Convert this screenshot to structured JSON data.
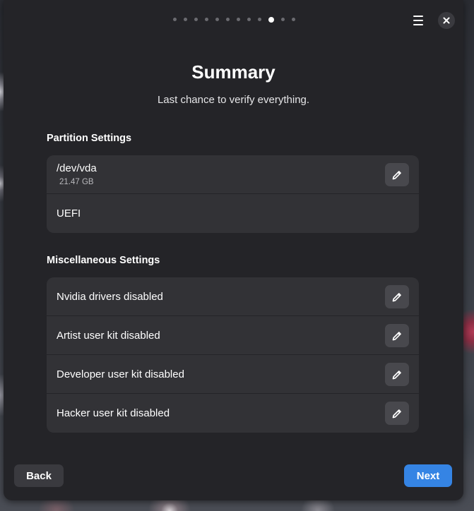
{
  "wizard": {
    "total_steps": 12,
    "current_step": 10,
    "title": "Summary",
    "subtitle": "Last chance to verify everything."
  },
  "header": {
    "menu_icon": "hamburger-menu-icon",
    "close_icon": "close-icon"
  },
  "partition": {
    "heading": "Partition Settings",
    "disk_name": "/dev/vda",
    "disk_size": "21.47 GB",
    "boot_mode": "UEFI",
    "edit_icon": "pencil-icon"
  },
  "misc": {
    "heading": "Miscellaneous Settings",
    "items": [
      {
        "label": "Nvidia drivers disabled"
      },
      {
        "label": "Artist user kit disabled"
      },
      {
        "label": "Developer user kit disabled"
      },
      {
        "label": "Hacker user kit disabled"
      }
    ]
  },
  "footer": {
    "back_label": "Back",
    "next_label": "Next"
  },
  "colors": {
    "accent": "#3584e4",
    "window_bg": "#242428",
    "card_bg": "#323236",
    "button_bg": "#48484d"
  }
}
